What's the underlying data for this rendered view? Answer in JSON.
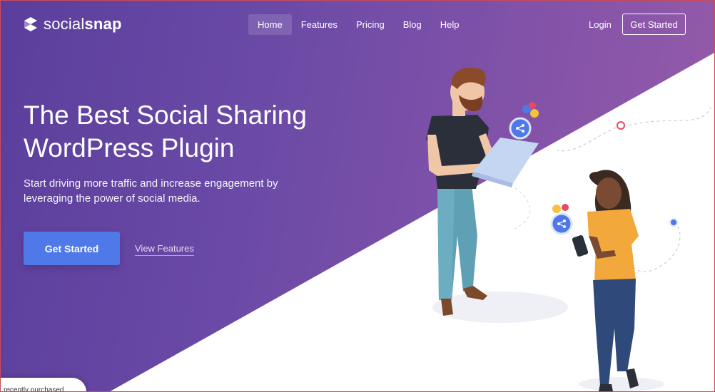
{
  "brand": {
    "name_light": "social",
    "name_bold": "snap"
  },
  "nav": {
    "links": [
      {
        "label": "Home",
        "active": true
      },
      {
        "label": "Features",
        "active": false
      },
      {
        "label": "Pricing",
        "active": false
      },
      {
        "label": "Blog",
        "active": false
      },
      {
        "label": "Help",
        "active": false
      }
    ],
    "login": "Login",
    "cta": "Get Started"
  },
  "hero": {
    "title_line1": "The Best Social Sharing",
    "title_line2": "WordPress Plugin",
    "subtitle_line1": "Start driving more traffic and increase engagement by",
    "subtitle_line2": "leveraging the power of social media.",
    "primary_button": "Get Started",
    "secondary_link": "View Features"
  },
  "toast": {
    "text": "recently purchased"
  },
  "colors": {
    "accent": "#4f78e8",
    "gradient_start": "#5b3e9c",
    "gradient_end": "#9a5ca9"
  }
}
